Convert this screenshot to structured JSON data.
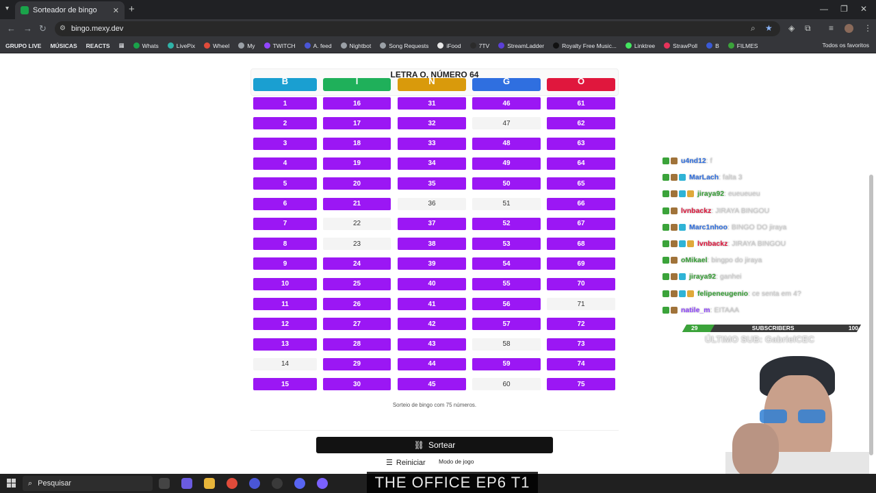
{
  "browser": {
    "tab_title": "Sorteador de bingo",
    "url": "bingo.mexy.dev",
    "bookmarks": [
      {
        "label": "GRUPO LIVE",
        "bold": true,
        "color": ""
      },
      {
        "label": "MÚSICAS",
        "bold": true,
        "color": ""
      },
      {
        "label": "REACTS",
        "bold": true,
        "color": ""
      },
      {
        "label": "Whats",
        "bold": false,
        "color": "#1aa34a"
      },
      {
        "label": "LivePix",
        "bold": false,
        "color": "#2fb3a8"
      },
      {
        "label": "Wheel",
        "bold": false,
        "color": "#e04b3a"
      },
      {
        "label": "My",
        "bold": false,
        "color": "#9aa0a6"
      },
      {
        "label": "TWITCH",
        "bold": false,
        "color": "#9146ff"
      },
      {
        "label": "A. feed",
        "bold": false,
        "color": "#4a56d6"
      },
      {
        "label": "Nightbot",
        "bold": false,
        "color": "#9aa0a6"
      },
      {
        "label": "Song Requests",
        "bold": false,
        "color": "#9aa0a6"
      },
      {
        "label": "iFood",
        "bold": false,
        "color": "#e8e8e8"
      },
      {
        "label": "7TV",
        "bold": false,
        "color": "#2b2b2b"
      },
      {
        "label": "StreamLadder",
        "bold": false,
        "color": "#5b3fd6"
      },
      {
        "label": "Royalty Free Music...",
        "bold": false,
        "color": "#111111"
      },
      {
        "label": "Linktree",
        "bold": false,
        "color": "#43e660"
      },
      {
        "label": "StrawPoll",
        "bold": false,
        "color": "#e6335a"
      },
      {
        "label": "B",
        "bold": false,
        "color": "#3a5ad6"
      },
      {
        "label": "FILMES",
        "bold": false,
        "color": "#3ba33a"
      }
    ],
    "all_bookmarks": "Todos os favoritos"
  },
  "bingo": {
    "announcement": "LETRA O, NÚMERO 64",
    "columns": [
      {
        "letter": "B",
        "color": "#1a9fd1",
        "drawn": [
          1,
          2,
          3,
          4,
          5,
          6,
          7,
          8,
          9,
          10,
          11,
          12,
          13,
          15
        ]
      },
      {
        "letter": "I",
        "color": "#1fb05a",
        "drawn": [
          16,
          17,
          18,
          19,
          20,
          21,
          24,
          25,
          26,
          27,
          28,
          29,
          30
        ]
      },
      {
        "letter": "N",
        "color": "#d99a0b",
        "drawn": [
          31,
          32,
          33,
          34,
          35,
          37,
          38,
          39,
          40,
          41,
          42,
          43,
          44,
          45
        ]
      },
      {
        "letter": "G",
        "color": "#2f6fe0",
        "drawn": [
          46,
          48,
          49,
          50,
          52,
          53,
          54,
          55,
          56,
          57,
          59
        ]
      },
      {
        "letter": "O",
        "color": "#e0173d",
        "drawn": [
          61,
          62,
          63,
          64,
          65,
          66,
          67,
          68,
          69,
          70,
          72,
          73,
          74,
          75
        ]
      }
    ],
    "cell_on_color": "#9b17f4",
    "footnote": "Sorteio de bingo com 75 números.",
    "draw_button": "Sortear",
    "reset_button": "Reiniciar",
    "mode_select": "Modo de jogo"
  },
  "chat": [
    {
      "user": "u4nd12",
      "msg": ": f",
      "color": "#2f6fe0"
    },
    {
      "user": "MarLach",
      "msg": ": falta 3",
      "color": "#2f6fe0"
    },
    {
      "user": "jiraya92",
      "msg": ": eueueueu",
      "color": "#3ba33a"
    },
    {
      "user": "lvnbackz",
      "msg": ": JIRAYA BINGOU",
      "color": "#e0173d"
    },
    {
      "user": "Marc1nhoo",
      "msg": ": BINGO DO jiraya",
      "color": "#2f6fe0"
    },
    {
      "user": "lvnbackz",
      "msg": ": JIRAYA BINGOU",
      "color": "#e0173d"
    },
    {
      "user": "oMikael",
      "msg": ": bingpo do jiraya",
      "color": "#3ba33a"
    },
    {
      "user": "jiraya92",
      "msg": ": ganhei",
      "color": "#3ba33a"
    },
    {
      "user": "felipeneugenio",
      "msg": ": ce senta em 4?",
      "color": "#3ba33a"
    },
    {
      "user": "natile_m",
      "msg": ": EITAAA",
      "color": "#9146ff"
    }
  ],
  "overlay": {
    "sub_current": "29",
    "sub_label": "SUBSCRIBERS",
    "sub_goal": "100",
    "sub_progress": 0.29,
    "last_sub": "ÚLTIMO SUB: GabrielCEC",
    "caption": "THE OFFICE EP6 T1"
  },
  "taskbar": {
    "search_placeholder": "Pesquisar"
  }
}
